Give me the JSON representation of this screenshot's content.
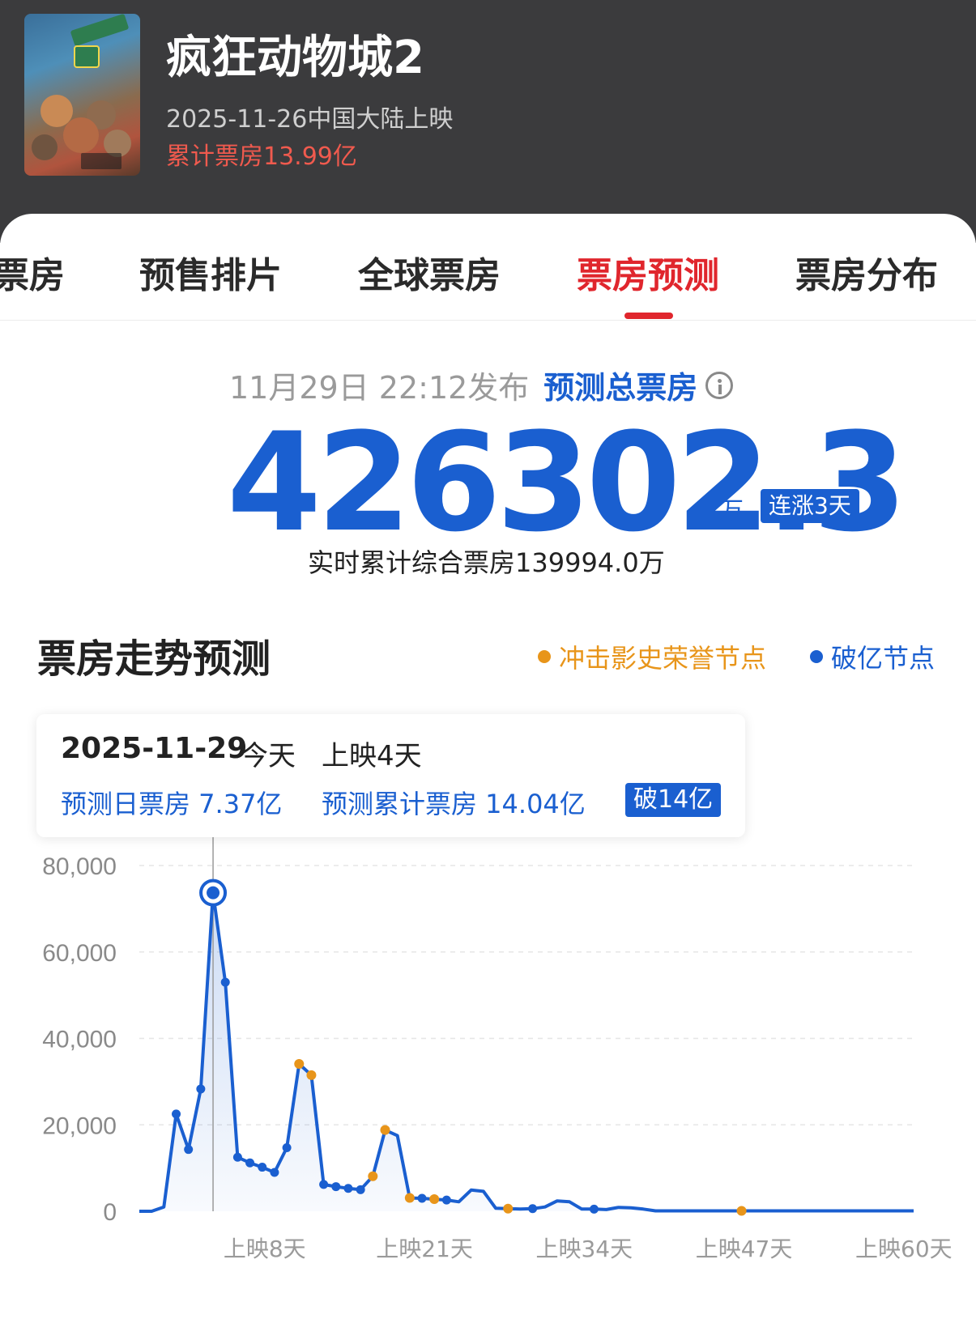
{
  "movie": {
    "title": "疯狂动物城2",
    "release": "2025-11-26中国大陆上映",
    "cumulative": "累计票房13.99亿"
  },
  "tabs": [
    {
      "label": "票房"
    },
    {
      "label": "预售排片"
    },
    {
      "label": "全球票房"
    },
    {
      "label": "票房预测",
      "active": true
    },
    {
      "label": "票房分布"
    }
  ],
  "forecast": {
    "published": "11月29日 22:12发布",
    "label": "预测总票房",
    "value": "426302.3",
    "unit": "万",
    "streak_badge": "连涨3天",
    "realtime": "实时累计综合票房139994.0万"
  },
  "trend": {
    "title": "票房走势预测",
    "legend_honor": "冲击影史荣誉节点",
    "legend_billion": "破亿节点"
  },
  "tooltip": {
    "date": "2025-11-29",
    "today": "今天",
    "days": "上映4天",
    "daily": "预测日票房 7.37亿",
    "cumulative": "预测累计票房 14.04亿",
    "badge": "破14亿"
  },
  "colors": {
    "accent_red": "#e0262d",
    "blue": "#1a5fd0",
    "orange": "#e8951a"
  },
  "chart_data": {
    "type": "line",
    "ylim": [
      0,
      80000
    ],
    "yticks": [
      0,
      20000,
      40000,
      60000,
      80000
    ],
    "ytick_labels": [
      "0",
      "20,000",
      "40,000",
      "60,000",
      "80,000"
    ],
    "xtick_labels": [
      {
        "day": 8,
        "label": "上映8天"
      },
      {
        "day": 21,
        "label": "上映21天"
      },
      {
        "day": 34,
        "label": "上映34天"
      },
      {
        "day": 47,
        "label": "上映47天"
      },
      {
        "day": 60,
        "label": "上映60天"
      }
    ],
    "x_range": [
      -2,
      61
    ],
    "series": [
      {
        "x": [
          -2,
          -1,
          0,
          1,
          2,
          3,
          4,
          5,
          6,
          7,
          8,
          9,
          10,
          11,
          12,
          13,
          14,
          15,
          16,
          17,
          18,
          19,
          20,
          21,
          22,
          23,
          24,
          25,
          26,
          27,
          28,
          29,
          30,
          31,
          32,
          33,
          34,
          35,
          36,
          37,
          38,
          39,
          40,
          41,
          42,
          43,
          44,
          45,
          46,
          47,
          48,
          49,
          50,
          51,
          52,
          53,
          54,
          55,
          56,
          57,
          58,
          59,
          60,
          61
        ],
        "values": [
          0,
          0,
          1000,
          22500,
          14300,
          28300,
          73700,
          53000,
          12500,
          11200,
          10200,
          9000,
          14700,
          34100,
          31500,
          6200,
          5700,
          5300,
          5000,
          8100,
          18800,
          17500,
          3100,
          3000,
          2800,
          2600,
          2200,
          4900,
          4600,
          700,
          600,
          500,
          600,
          1000,
          2400,
          2200,
          500,
          500,
          400,
          900,
          800,
          500,
          100,
          100,
          100,
          100,
          100,
          100,
          100,
          100,
          100,
          100,
          100,
          100,
          100,
          100,
          100,
          100,
          100,
          100,
          100,
          100,
          100,
          100
        ],
        "orange_days": [
          11,
          12,
          17,
          18,
          20,
          22,
          28,
          47
        ],
        "blue_days": [
          1,
          2,
          3,
          5,
          6,
          7,
          8,
          9,
          10,
          13,
          14,
          15,
          16,
          21,
          23,
          30,
          35
        ],
        "highlight_day": 4
      }
    ]
  }
}
